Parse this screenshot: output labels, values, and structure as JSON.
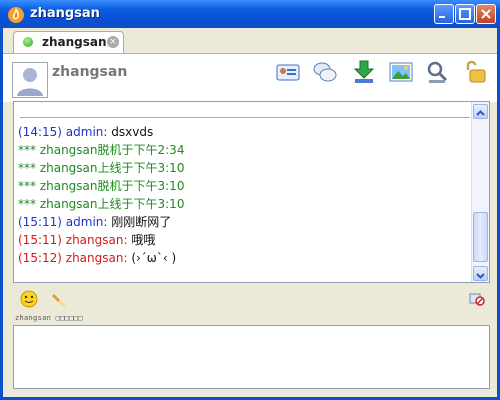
{
  "window": {
    "title": "zhangsan",
    "colors": {
      "titlebar": "#0a51d6",
      "self": "#d31a1a",
      "admin": "#1c35c8",
      "system": "#1f8a1f"
    }
  },
  "tab": {
    "label": "zhangsan",
    "close_icon": "close-circle-icon"
  },
  "contact": {
    "name": "zhangsan"
  },
  "toolbar_icons": [
    "profile-card-icon",
    "chat-bubbles-icon",
    "file-transfer-icon",
    "picture-icon",
    "settings-icon",
    "unlock-icon"
  ],
  "messages": [
    {
      "time": "(14:15)",
      "sender": "admin:",
      "text": " dsxvds",
      "type": "admin"
    },
    {
      "time": "",
      "sender": "",
      "text": "*** zhangsan脱机于下午2:34",
      "type": "system"
    },
    {
      "time": "",
      "sender": "",
      "text": "*** zhangsan上线于下午3:10",
      "type": "system"
    },
    {
      "time": "",
      "sender": "",
      "text": "*** zhangsan脱机于下午3:10",
      "type": "system"
    },
    {
      "time": "",
      "sender": "",
      "text": "*** zhangsan上线于下午3:10",
      "type": "system"
    },
    {
      "time": "(15:11)",
      "sender": "admin:",
      "text": " 刚刚断网了",
      "type": "admin"
    },
    {
      "time": "(15:11)",
      "sender": "zhangsan:",
      "text": " 哦哦",
      "type": "self"
    },
    {
      "time": "(15:12)",
      "sender": "zhangsan:",
      "text": " (›´ω`‹ )",
      "type": "self"
    }
  ],
  "input": {
    "typing_status": "zhangsan □□□□□□",
    "value": ""
  }
}
